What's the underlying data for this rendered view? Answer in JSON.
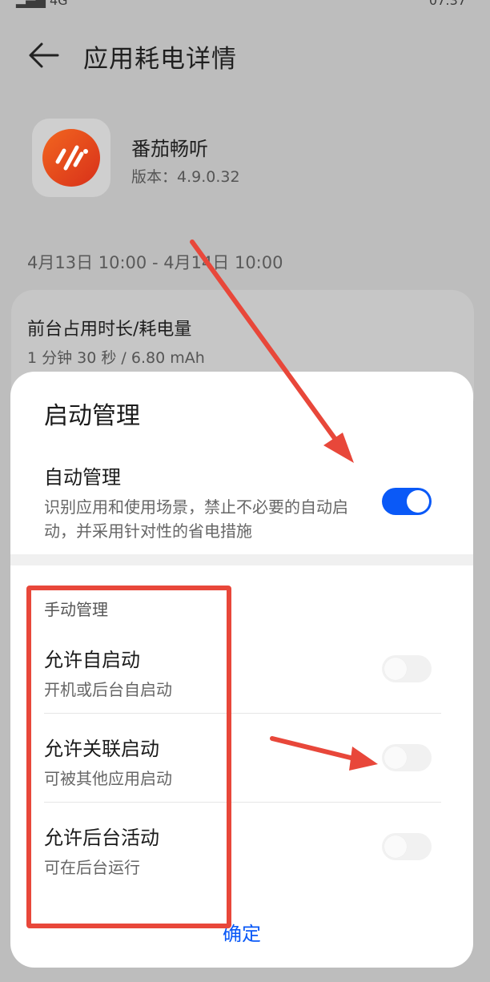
{
  "status_bar": {
    "left_text": "▂▄▆ 4G",
    "right_text": "07:37"
  },
  "header": {
    "title": "应用耗电详情",
    "back_icon": "back-arrow-icon"
  },
  "app": {
    "name": "番茄畅听",
    "version_label": "版本：",
    "version": "4.9.0.32",
    "icon": "tomato-listen-app-icon",
    "icon_color": "#e8471c"
  },
  "date_range": "4月13日 10:00 - 4月14日 10:00",
  "foreground": {
    "title": "前台占用时长/耗电量",
    "value": "1 分钟 30 秒 / 6.80 mAh"
  },
  "dialog": {
    "title": "启动管理",
    "auto": {
      "title": "自动管理",
      "description": "识别应用和使用场景，禁止不必要的自动启动，并采用针对性的省电措施",
      "enabled": true
    },
    "manual": {
      "section_label": "手动管理",
      "items": [
        {
          "title": "允许自启动",
          "description": "开机或后台自启动",
          "enabled": false
        },
        {
          "title": "允许关联启动",
          "description": "可被其他应用启动",
          "enabled": false
        },
        {
          "title": "允许后台活动",
          "description": "可在后台运行",
          "enabled": false
        }
      ]
    },
    "confirm_label": "确定"
  },
  "colors": {
    "accent": "#0a59f7",
    "annotation": "#e8473a"
  }
}
